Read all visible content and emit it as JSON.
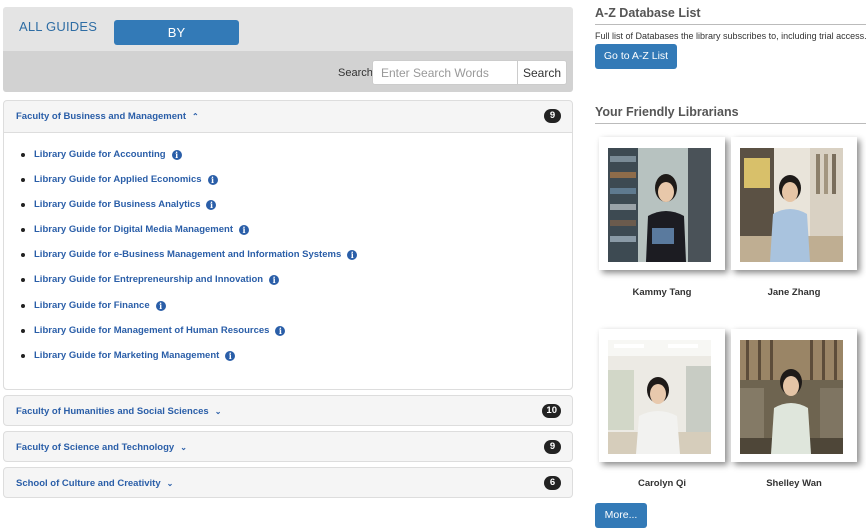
{
  "tabs": {
    "all_guides": "ALL GUIDES",
    "by_faculty": "BY FACULTY/SCHOOL"
  },
  "search": {
    "label": "Search:",
    "placeholder": "Enter Search Words",
    "button": "Search"
  },
  "faculties": [
    {
      "name": "Faculty of Business and Management",
      "count": "9",
      "expanded": true,
      "guides": [
        "Library Guide for Accounting",
        "Library Guide for Applied Economics",
        "Library Guide for Business Analytics",
        "Library Guide for Digital Media Management",
        "Library Guide for e-Business Management and Information Systems",
        "Library Guide for Entrepreneurship and Innovation",
        "Library Guide for Finance",
        "Library Guide for Management of Human Resources",
        "Library Guide for Marketing Management"
      ]
    },
    {
      "name": "Faculty of Humanities and Social Sciences",
      "count": "10",
      "expanded": false
    },
    {
      "name": "Faculty of Science and Technology",
      "count": "9",
      "expanded": false
    },
    {
      "name": "School of Culture and Creativity",
      "count": "6",
      "expanded": false
    }
  ],
  "az": {
    "title": "A-Z Database List",
    "description": "Full list of Databases the library subscribes to, including trial access.",
    "button": "Go to A-Z List"
  },
  "librarians": {
    "title": "Your Friendly Librarians",
    "people": [
      {
        "name": "Kammy Tang"
      },
      {
        "name": "Jane Zhang"
      },
      {
        "name": "Carolyn Qi"
      },
      {
        "name": "Shelley Wan"
      }
    ],
    "more_button": "More..."
  },
  "colors": {
    "accent": "#337ab7",
    "link": "#2a5ea8",
    "badge": "#222222"
  },
  "icons": {
    "info": "info-icon",
    "expanded_chevron": "chevron-up-icon",
    "collapsed_chevron": "chevron-down-icon"
  }
}
